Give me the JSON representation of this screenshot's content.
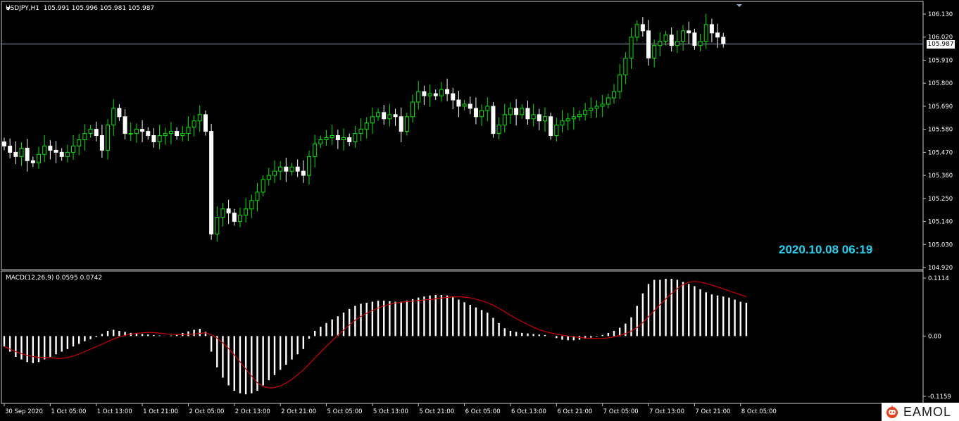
{
  "header": {
    "symbol_line": "USDJPY,H1  105.991 105.996 105.981 105.987",
    "macd_line": "MACD(12,26,9) 0.0595 0.0742"
  },
  "timestamp": "2020.10.08 06:19",
  "current_price_label": "105.987",
  "brand": {
    "text": "EAMOL",
    "icon": "robot-icon"
  },
  "colors": {
    "background": "#000000",
    "bull_candle": "#00e600",
    "bear_candle": "#ffffff",
    "signal_line": "#cc0000",
    "histogram": "#ffffff",
    "timestamp": "#1fd3f0"
  },
  "chart_data": [
    {
      "type": "candlestick",
      "series": [
        {
          "name": "USDJPY,H1"
        }
      ],
      "ylim": [
        104.93,
        106.17
      ],
      "y_ticks": [
        "106.130",
        "106.020",
        "105.910",
        "105.800",
        "105.690",
        "105.580",
        "105.470",
        "105.360",
        "105.250",
        "105.140",
        "105.030",
        "104.920"
      ],
      "current_price": 105.987,
      "x_ticks": [
        "30 Sep 2020",
        "1 Oct 05:00",
        "1 Oct 13:00",
        "1 Oct 21:00",
        "2 Oct 05:00",
        "2 Oct 13:00",
        "2 Oct 21:00",
        "5 Oct 05:00",
        "5 Oct 13:00",
        "5 Oct 21:00",
        "6 Oct 05:00",
        "6 Oct 13:00",
        "6 Oct 21:00",
        "7 Oct 05:00",
        "7 Oct 13:00",
        "7 Oct 21:00",
        "8 Oct 05:00"
      ],
      "closes": [
        105.5,
        105.47,
        105.45,
        105.49,
        105.43,
        105.42,
        105.46,
        105.5,
        105.48,
        105.47,
        105.45,
        105.47,
        105.5,
        105.53,
        105.56,
        105.58,
        105.55,
        105.48,
        105.6,
        105.68,
        105.64,
        105.56,
        105.56,
        105.58,
        105.57,
        105.55,
        105.52,
        105.55,
        105.56,
        105.57,
        105.55,
        105.56,
        105.59,
        105.62,
        105.65,
        105.57,
        105.08,
        105.16,
        105.2,
        105.18,
        105.14,
        105.17,
        105.2,
        105.24,
        105.28,
        105.34,
        105.36,
        105.38,
        105.4,
        105.38,
        105.4,
        105.38,
        105.36,
        105.45,
        105.51,
        105.53,
        105.54,
        105.55,
        105.53,
        105.54,
        105.52,
        105.56,
        105.58,
        105.61,
        105.64,
        105.66,
        105.63,
        105.65,
        105.64,
        105.57,
        105.64,
        105.71,
        105.76,
        105.74,
        105.75,
        105.74,
        105.77,
        105.75,
        105.72,
        105.69,
        105.7,
        105.68,
        105.64,
        105.67,
        105.69,
        105.56,
        105.6,
        105.65,
        105.68,
        105.65,
        105.68,
        105.63,
        105.65,
        105.62,
        105.64,
        105.55,
        105.6,
        105.62,
        105.63,
        105.64,
        105.65,
        105.67,
        105.68,
        105.69,
        105.7,
        105.73,
        105.76,
        105.84,
        105.92,
        106.02,
        106.08,
        106.05,
        105.92,
        105.98,
        106.0,
        106.03,
        105.98,
        106.0,
        106.05,
        106.04,
        105.98,
        106.0,
        106.08,
        106.04,
        106.02,
        105.99
      ]
    },
    {
      "type": "bar",
      "series": [
        {
          "name": "MACD(12,26,9)"
        }
      ],
      "ylim": [
        -0.1159,
        0.1114
      ],
      "y_ticks": [
        "0.1114",
        "0.00",
        "-0.1159"
      ],
      "histogram": [
        -0.02,
        -0.03,
        -0.04,
        -0.045,
        -0.05,
        -0.052,
        -0.05,
        -0.045,
        -0.04,
        -0.035,
        -0.03,
        -0.025,
        -0.02,
        -0.015,
        -0.01,
        -0.006,
        -0.002,
        0.004,
        0.01,
        0.012,
        0.01,
        0.008,
        0.006,
        0.005,
        0.004,
        0.003,
        0.002,
        0.001,
        0.0,
        0.001,
        0.003,
        0.006,
        0.009,
        0.012,
        0.014,
        0.008,
        -0.03,
        -0.06,
        -0.08,
        -0.095,
        -0.105,
        -0.11,
        -0.112,
        -0.11,
        -0.105,
        -0.095,
        -0.085,
        -0.075,
        -0.065,
        -0.055,
        -0.045,
        -0.035,
        -0.025,
        -0.005,
        0.01,
        0.018,
        0.025,
        0.032,
        0.038,
        0.045,
        0.052,
        0.058,
        0.062,
        0.064,
        0.066,
        0.068,
        0.068,
        0.067,
        0.066,
        0.066,
        0.068,
        0.071,
        0.074,
        0.076,
        0.078,
        0.079,
        0.079,
        0.078,
        0.075,
        0.07,
        0.065,
        0.06,
        0.055,
        0.05,
        0.045,
        0.035,
        0.025,
        0.015,
        0.01,
        0.008,
        0.006,
        0.005,
        0.004,
        0.003,
        0.002,
        0.0,
        -0.004,
        -0.007,
        -0.008,
        -0.008,
        -0.007,
        -0.005,
        -0.003,
        -0.001,
        0.002,
        0.006,
        0.01,
        0.016,
        0.024,
        0.036,
        0.058,
        0.082,
        0.1,
        0.108,
        0.108,
        0.11,
        0.11,
        0.108,
        0.104,
        0.1,
        0.096,
        0.09,
        0.084,
        0.08,
        0.078,
        0.076,
        0.074,
        0.07,
        0.066,
        0.064
      ]
    }
  ]
}
